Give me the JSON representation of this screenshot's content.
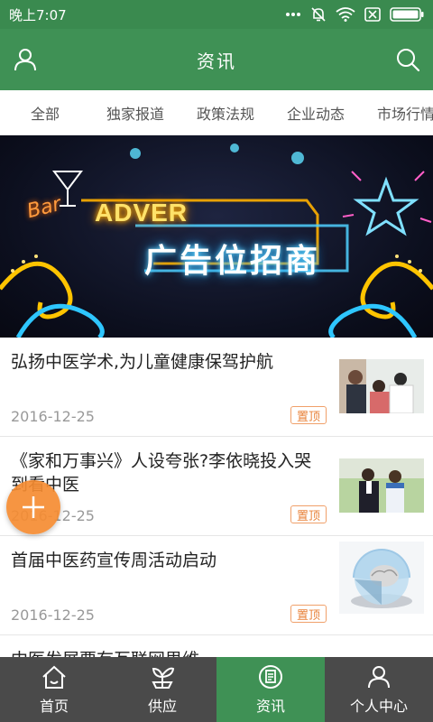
{
  "status_bar": {
    "time": "晚上7:07",
    "icons": [
      "more-dots-icon",
      "bell-muted-icon",
      "wifi-icon",
      "sim-off-icon",
      "battery-icon"
    ]
  },
  "header": {
    "title": "资讯",
    "left_icon": "user-icon",
    "right_icon": "search-icon",
    "background": "#3f9155"
  },
  "tabs": [
    "全部",
    "独家报道",
    "政策法规",
    "企业动态",
    "市场行情"
  ],
  "banner": {
    "bar_text": "Bar",
    "ad_text": "ADVER",
    "headline": "广告位招商"
  },
  "news": [
    {
      "title": "弘扬中医学术,为儿童健康保驾护航",
      "date": "2016-12-25",
      "badge": "置顶",
      "thumb": "doctor-child-photo"
    },
    {
      "title": "《家和万事兴》人设夸张?李依晓投入哭到看中医",
      "date": "2016-12-25",
      "badge": "置顶",
      "thumb": "couple-photo"
    },
    {
      "title": "首届中医药宣传周活动启动",
      "date": "2016-12-25",
      "badge": "置顶",
      "thumb": "brain-sphere-photo"
    },
    {
      "title": "中医发展要有互联网思维",
      "date": "",
      "badge": "",
      "thumb": ""
    }
  ],
  "fab": {
    "icon": "plus-icon",
    "color": "#f58c32"
  },
  "bottom_nav": [
    {
      "label": "首页",
      "icon": "home-icon",
      "active": false
    },
    {
      "label": "供应",
      "icon": "plant-icon",
      "active": false
    },
    {
      "label": "资讯",
      "icon": "news-icon",
      "active": true
    },
    {
      "label": "个人中心",
      "icon": "person-icon",
      "active": false
    }
  ],
  "colors": {
    "primary": "#3f9155",
    "badge": "#e8823a",
    "nav_bg": "#4a4a4a"
  }
}
